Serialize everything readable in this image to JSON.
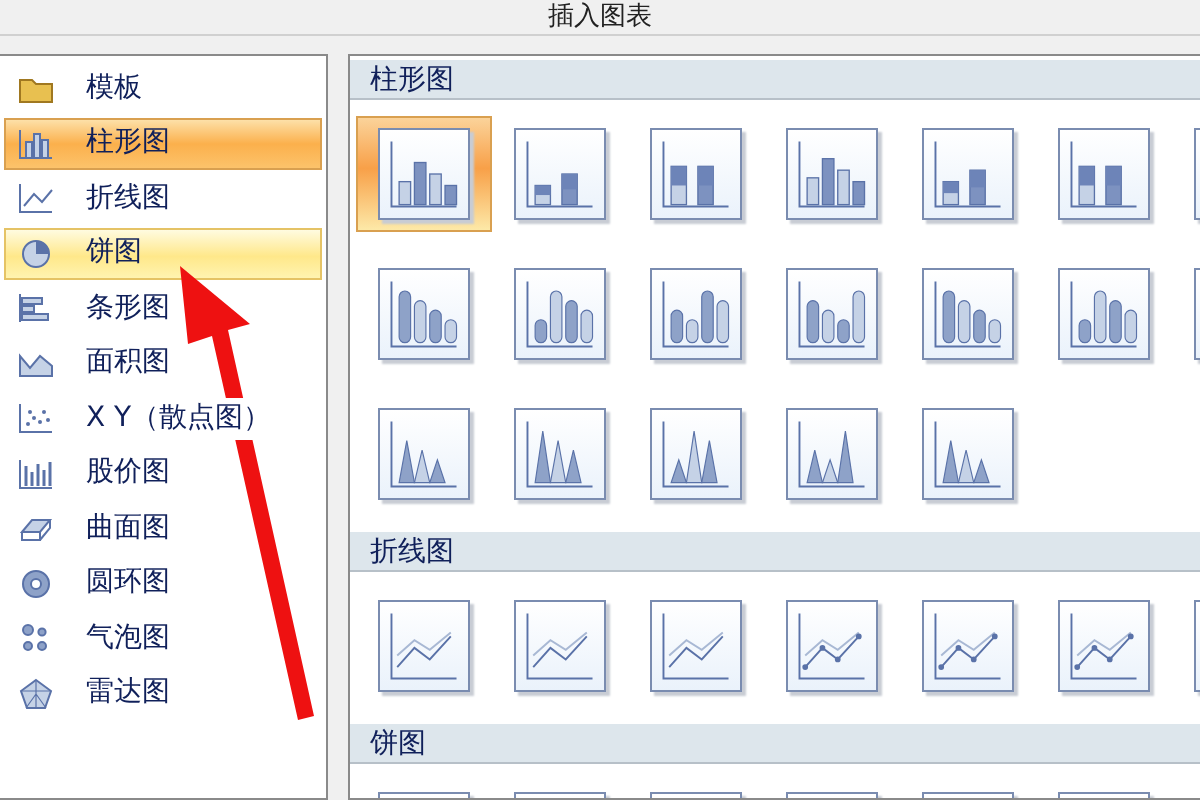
{
  "window": {
    "title": "插入图表"
  },
  "sidebar": {
    "items": [
      {
        "label": "模板",
        "selected": false,
        "hovered": false
      },
      {
        "label": "柱形图",
        "selected": true,
        "hovered": false
      },
      {
        "label": "折线图",
        "selected": false,
        "hovered": false
      },
      {
        "label": "饼图",
        "selected": false,
        "hovered": true
      },
      {
        "label": "条形图",
        "selected": false,
        "hovered": false
      },
      {
        "label": "面积图",
        "selected": false,
        "hovered": false
      },
      {
        "label": "X Y（散点图）",
        "selected": false,
        "hovered": false
      },
      {
        "label": "股价图",
        "selected": false,
        "hovered": false
      },
      {
        "label": "曲面图",
        "selected": false,
        "hovered": false
      },
      {
        "label": "圆环图",
        "selected": false,
        "hovered": false
      },
      {
        "label": "气泡图",
        "selected": false,
        "hovered": false
      },
      {
        "label": "雷达图",
        "selected": false,
        "hovered": false
      }
    ]
  },
  "gallery": {
    "sections": [
      {
        "title": "柱形图",
        "kind": "column",
        "items": [
          {
            "selected": true
          },
          {
            "selected": false
          },
          {
            "selected": false
          },
          {
            "selected": false
          },
          {
            "selected": false
          },
          {
            "selected": false
          },
          {
            "selected": false
          },
          {
            "selected": false
          },
          {
            "selected": false
          },
          {
            "selected": false
          },
          {
            "selected": false
          },
          {
            "selected": false
          },
          {
            "selected": false
          },
          {
            "selected": false
          },
          {
            "selected": false
          },
          {
            "selected": false
          },
          {
            "selected": false
          },
          {
            "selected": false
          },
          {
            "selected": false
          }
        ]
      },
      {
        "title": "折线图",
        "kind": "line",
        "items": [
          {
            "selected": false
          },
          {
            "selected": false
          },
          {
            "selected": false
          },
          {
            "selected": false
          },
          {
            "selected": false
          },
          {
            "selected": false
          },
          {
            "selected": false
          }
        ]
      },
      {
        "title": "饼图",
        "kind": "pie",
        "items": [
          {
            "selected": false
          },
          {
            "selected": false
          },
          {
            "selected": false
          },
          {
            "selected": false
          },
          {
            "selected": false
          },
          {
            "selected": false
          }
        ]
      }
    ]
  }
}
